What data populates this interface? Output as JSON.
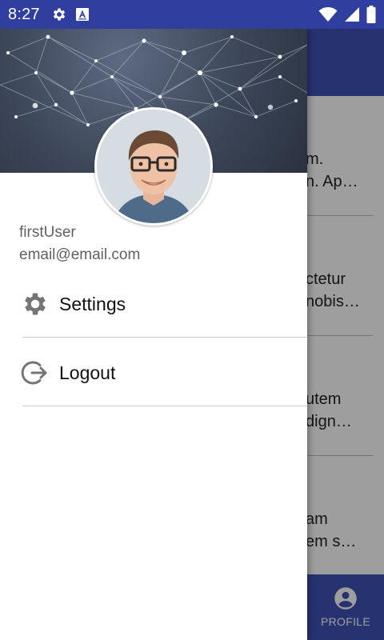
{
  "status_bar": {
    "time": "8:27",
    "left_icons": [
      "settings-icon",
      "font-a-icon"
    ],
    "right_icons": [
      "wifi-icon",
      "signal-icon",
      "battery-icon"
    ],
    "color": "#303f9f"
  },
  "background": {
    "toolbar_color": "#3f51b5",
    "feed": [
      {
        "line1": "m.",
        "line2": "n. Ap…"
      },
      {
        "line1": "ctetur",
        "line2": "nobis…"
      },
      {
        "line1": "utem",
        "line2": "dign…"
      },
      {
        "line1": "am",
        "line2": "em s…"
      }
    ],
    "bottom_nav": {
      "profile_label": "PROFILE",
      "profile_icon": "account-circle-icon",
      "color": "#3f51b5"
    }
  },
  "drawer": {
    "header_image": "network-pattern",
    "avatar": "user-avatar-photo",
    "user": {
      "name": "firstUser",
      "email": "email@email.com"
    },
    "menu": [
      {
        "label": "Settings",
        "icon": "gear-icon"
      },
      {
        "label": "Logout",
        "icon": "logout-icon"
      }
    ]
  }
}
